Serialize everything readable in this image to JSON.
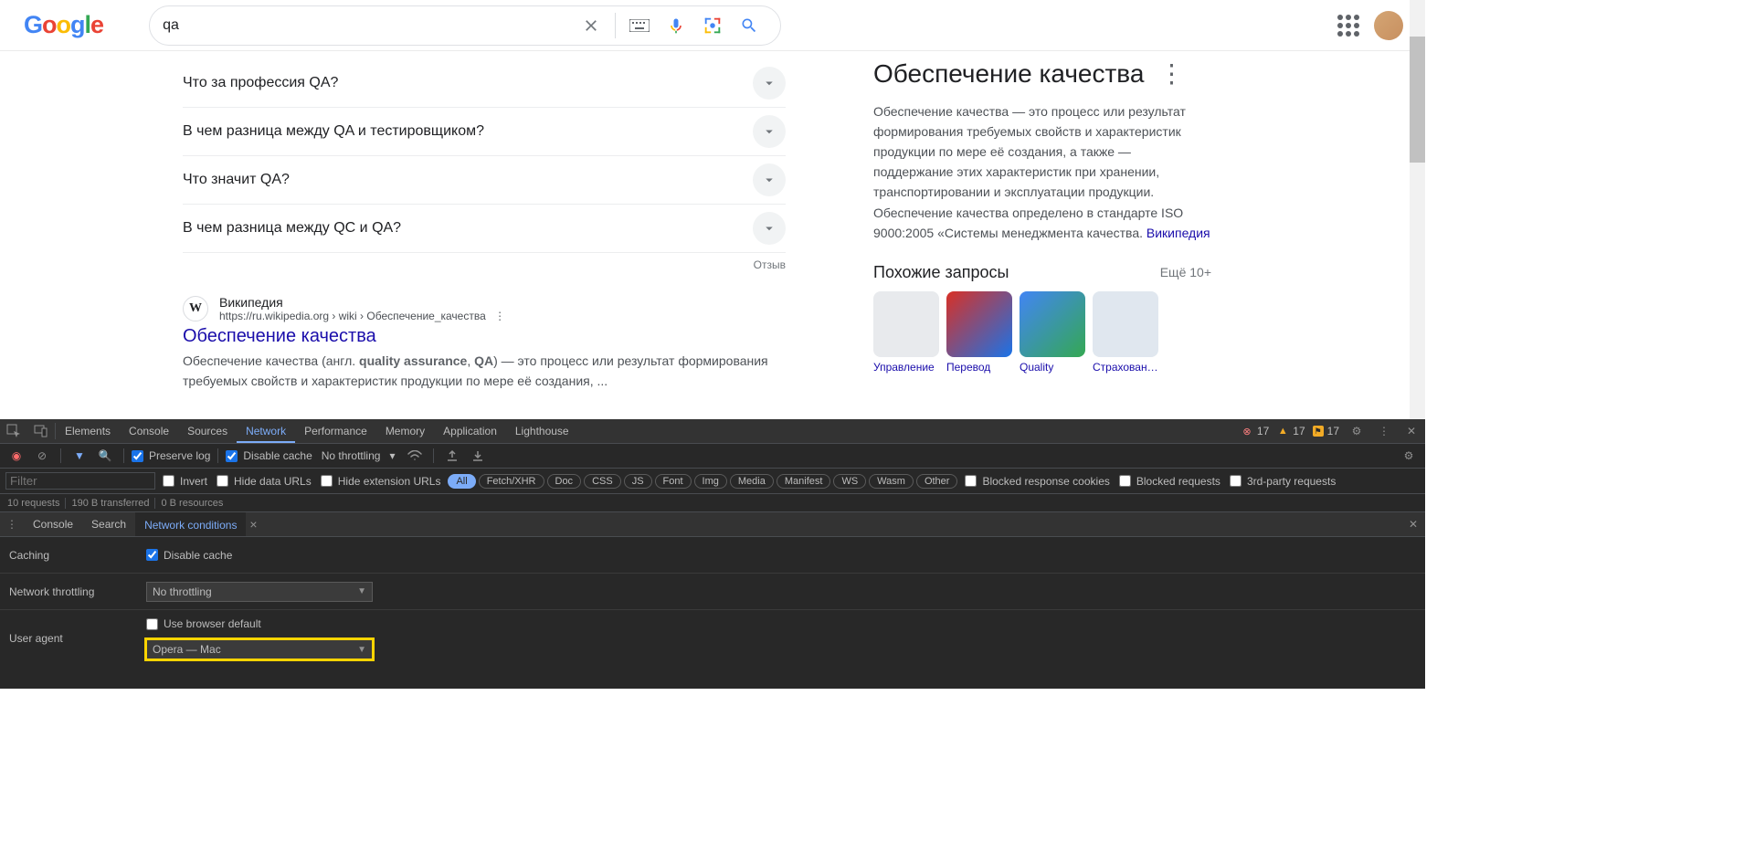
{
  "search": {
    "query": "qa"
  },
  "paa": [
    "Что за профессия QA?",
    "В чем разница между QA и тестировщиком?",
    "Что значит QA?",
    "В чем разница между QC и QA?"
  ],
  "paa_feedback": "Отзыв",
  "result": {
    "site": "Википедия",
    "url": "https://ru.wikipedia.org › wiki › Обеспечение_качества",
    "title": "Обеспечение качества",
    "snippet_pre": "Обеспечение качества (англ. ",
    "snippet_b1": "quality assurance",
    "snippet_mid": ", ",
    "snippet_b2": "QA",
    "snippet_post": ") — это процесс или результат формирования требуемых свойств и характеристик продукции по мере её создания, ..."
  },
  "kp": {
    "title": "Обеспечение качества",
    "desc": "Обеспечение качества — это процесс или результат формирования требуемых свойств и характеристик продукции по мере её создания, а также — поддержание этих характеристик при хранении, транспортировании и эксплуатации продукции. Обеспечение качества определено в стандарте ISO 9000:2005 «Системы менеджмента качества. ",
    "source": "Википедия",
    "related_heading": "Похожие запросы",
    "more": "Ещё 10+",
    "thumbs": [
      "Управление",
      "Перевод",
      "Quality",
      "Страхование"
    ]
  },
  "devtools": {
    "tabs": [
      "Elements",
      "Console",
      "Sources",
      "Network",
      "Performance",
      "Memory",
      "Application",
      "Lighthouse"
    ],
    "active_tab": "Network",
    "errors": "17",
    "warnings": "17",
    "issues": "17",
    "toolbar": {
      "preserve_log": "Preserve log",
      "disable_cache": "Disable cache",
      "throttling": "No throttling"
    },
    "filter_placeholder": "Filter",
    "filter_chk": [
      "Invert",
      "Hide data URLs",
      "Hide extension URLs"
    ],
    "chips": [
      "All",
      "Fetch/XHR",
      "Doc",
      "CSS",
      "JS",
      "Font",
      "Img",
      "Media",
      "Manifest",
      "WS",
      "Wasm",
      "Other"
    ],
    "chips_active": "All",
    "filter_chk2": [
      "Blocked response cookies",
      "Blocked requests",
      "3rd-party requests"
    ],
    "status": [
      "10 requests",
      "190 B transferred",
      "0 B resources"
    ],
    "drawer_tabs": [
      "Console",
      "Search",
      "Network conditions"
    ],
    "drawer_active": "Network conditions",
    "nc": {
      "caching_label": "Caching",
      "caching_chk": "Disable cache",
      "throttling_label": "Network throttling",
      "throttling_val": "No throttling",
      "ua_label": "User agent",
      "ua_chk": "Use browser default",
      "ua_val": "Opera — Mac"
    }
  }
}
